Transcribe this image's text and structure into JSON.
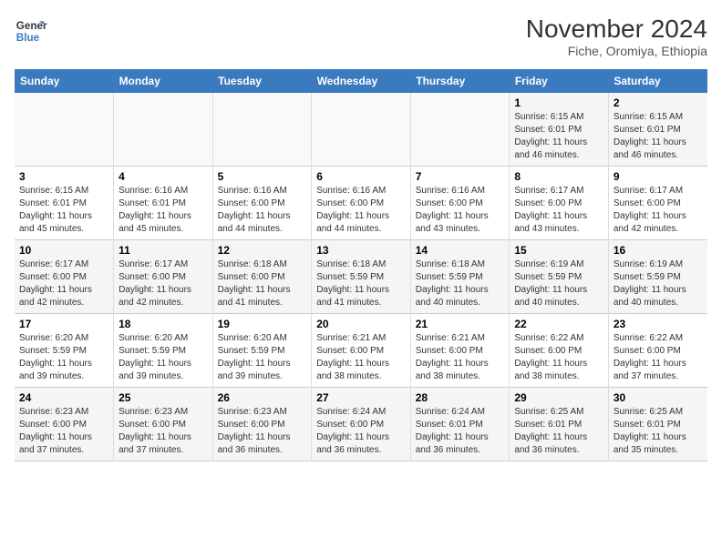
{
  "header": {
    "logo_line1": "General",
    "logo_line2": "Blue",
    "title": "November 2024",
    "subtitle": "Fiche, Oromiya, Ethiopia"
  },
  "columns": [
    "Sunday",
    "Monday",
    "Tuesday",
    "Wednesday",
    "Thursday",
    "Friday",
    "Saturday"
  ],
  "weeks": [
    [
      {
        "day": "",
        "text": ""
      },
      {
        "day": "",
        "text": ""
      },
      {
        "day": "",
        "text": ""
      },
      {
        "day": "",
        "text": ""
      },
      {
        "day": "",
        "text": ""
      },
      {
        "day": "1",
        "text": "Sunrise: 6:15 AM\nSunset: 6:01 PM\nDaylight: 11 hours and 46 minutes."
      },
      {
        "day": "2",
        "text": "Sunrise: 6:15 AM\nSunset: 6:01 PM\nDaylight: 11 hours and 46 minutes."
      }
    ],
    [
      {
        "day": "3",
        "text": "Sunrise: 6:15 AM\nSunset: 6:01 PM\nDaylight: 11 hours and 45 minutes."
      },
      {
        "day": "4",
        "text": "Sunrise: 6:16 AM\nSunset: 6:01 PM\nDaylight: 11 hours and 45 minutes."
      },
      {
        "day": "5",
        "text": "Sunrise: 6:16 AM\nSunset: 6:00 PM\nDaylight: 11 hours and 44 minutes."
      },
      {
        "day": "6",
        "text": "Sunrise: 6:16 AM\nSunset: 6:00 PM\nDaylight: 11 hours and 44 minutes."
      },
      {
        "day": "7",
        "text": "Sunrise: 6:16 AM\nSunset: 6:00 PM\nDaylight: 11 hours and 43 minutes."
      },
      {
        "day": "8",
        "text": "Sunrise: 6:17 AM\nSunset: 6:00 PM\nDaylight: 11 hours and 43 minutes."
      },
      {
        "day": "9",
        "text": "Sunrise: 6:17 AM\nSunset: 6:00 PM\nDaylight: 11 hours and 42 minutes."
      }
    ],
    [
      {
        "day": "10",
        "text": "Sunrise: 6:17 AM\nSunset: 6:00 PM\nDaylight: 11 hours and 42 minutes."
      },
      {
        "day": "11",
        "text": "Sunrise: 6:17 AM\nSunset: 6:00 PM\nDaylight: 11 hours and 42 minutes."
      },
      {
        "day": "12",
        "text": "Sunrise: 6:18 AM\nSunset: 6:00 PM\nDaylight: 11 hours and 41 minutes."
      },
      {
        "day": "13",
        "text": "Sunrise: 6:18 AM\nSunset: 5:59 PM\nDaylight: 11 hours and 41 minutes."
      },
      {
        "day": "14",
        "text": "Sunrise: 6:18 AM\nSunset: 5:59 PM\nDaylight: 11 hours and 40 minutes."
      },
      {
        "day": "15",
        "text": "Sunrise: 6:19 AM\nSunset: 5:59 PM\nDaylight: 11 hours and 40 minutes."
      },
      {
        "day": "16",
        "text": "Sunrise: 6:19 AM\nSunset: 5:59 PM\nDaylight: 11 hours and 40 minutes."
      }
    ],
    [
      {
        "day": "17",
        "text": "Sunrise: 6:20 AM\nSunset: 5:59 PM\nDaylight: 11 hours and 39 minutes."
      },
      {
        "day": "18",
        "text": "Sunrise: 6:20 AM\nSunset: 5:59 PM\nDaylight: 11 hours and 39 minutes."
      },
      {
        "day": "19",
        "text": "Sunrise: 6:20 AM\nSunset: 5:59 PM\nDaylight: 11 hours and 39 minutes."
      },
      {
        "day": "20",
        "text": "Sunrise: 6:21 AM\nSunset: 6:00 PM\nDaylight: 11 hours and 38 minutes."
      },
      {
        "day": "21",
        "text": "Sunrise: 6:21 AM\nSunset: 6:00 PM\nDaylight: 11 hours and 38 minutes."
      },
      {
        "day": "22",
        "text": "Sunrise: 6:22 AM\nSunset: 6:00 PM\nDaylight: 11 hours and 38 minutes."
      },
      {
        "day": "23",
        "text": "Sunrise: 6:22 AM\nSunset: 6:00 PM\nDaylight: 11 hours and 37 minutes."
      }
    ],
    [
      {
        "day": "24",
        "text": "Sunrise: 6:23 AM\nSunset: 6:00 PM\nDaylight: 11 hours and 37 minutes."
      },
      {
        "day": "25",
        "text": "Sunrise: 6:23 AM\nSunset: 6:00 PM\nDaylight: 11 hours and 37 minutes."
      },
      {
        "day": "26",
        "text": "Sunrise: 6:23 AM\nSunset: 6:00 PM\nDaylight: 11 hours and 36 minutes."
      },
      {
        "day": "27",
        "text": "Sunrise: 6:24 AM\nSunset: 6:00 PM\nDaylight: 11 hours and 36 minutes."
      },
      {
        "day": "28",
        "text": "Sunrise: 6:24 AM\nSunset: 6:01 PM\nDaylight: 11 hours and 36 minutes."
      },
      {
        "day": "29",
        "text": "Sunrise: 6:25 AM\nSunset: 6:01 PM\nDaylight: 11 hours and 36 minutes."
      },
      {
        "day": "30",
        "text": "Sunrise: 6:25 AM\nSunset: 6:01 PM\nDaylight: 11 hours and 35 minutes."
      }
    ]
  ]
}
